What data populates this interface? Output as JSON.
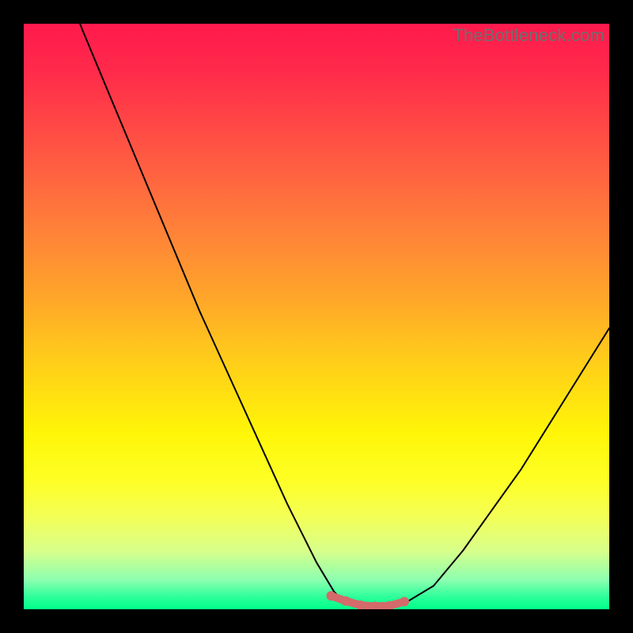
{
  "watermark": {
    "text": "TheBottleneck.com"
  },
  "colors": {
    "curve_stroke": "#000000",
    "marker_stroke": "#d46a6a",
    "marker_fill": "#d46a6a"
  },
  "chart_data": {
    "type": "line",
    "title": "",
    "xlabel": "",
    "ylabel": "",
    "xlim": [
      0,
      100
    ],
    "ylim": [
      0,
      100
    ],
    "grid": false,
    "series": [
      {
        "name": "bottleneck-curve",
        "x": [
          0,
          5,
          10,
          15,
          20,
          25,
          30,
          35,
          40,
          45,
          50,
          53,
          55,
          58,
          60,
          62,
          65,
          70,
          75,
          80,
          85,
          90,
          95,
          100
        ],
        "values": [
          125,
          112,
          99,
          87,
          75,
          63,
          51,
          40,
          29,
          18,
          8,
          3,
          1,
          0,
          0,
          0,
          1,
          4,
          10,
          17,
          24,
          32,
          40,
          48
        ]
      }
    ],
    "markers": {
      "name": "optimal-range",
      "x": [
        52.5,
        55.0,
        57.5,
        60.0,
        62.5,
        65.0
      ],
      "values": [
        2.3,
        1.4,
        0.7,
        0.5,
        0.6,
        1.3
      ]
    }
  }
}
